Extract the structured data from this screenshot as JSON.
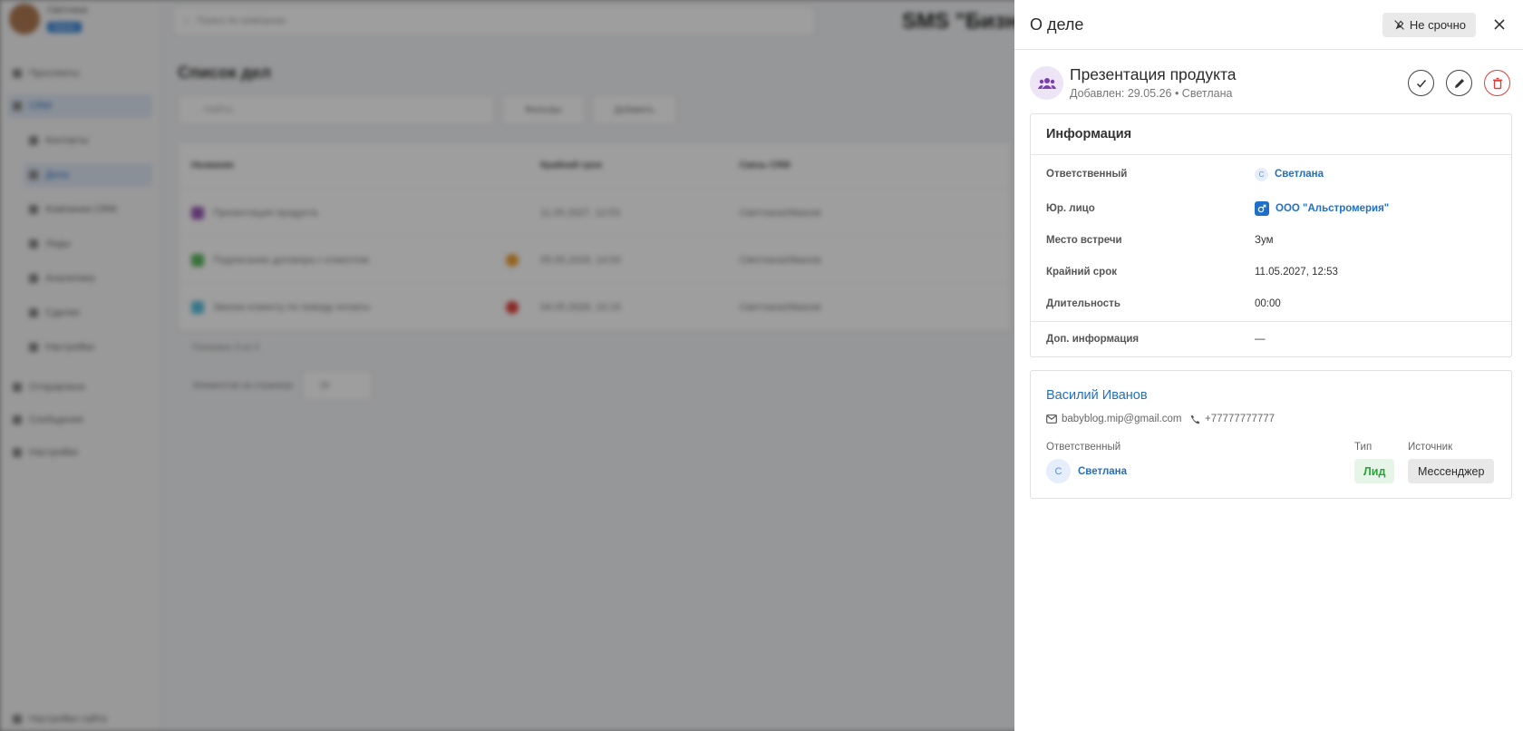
{
  "background": {
    "sidebar": {
      "user_name": "Светлана",
      "user_role": "Admin",
      "items": [
        "Проспекты",
        "CRM",
        "Контакты",
        "Дела",
        "Компании CRM",
        "Лиды",
        "Аналитика",
        "Сделки",
        "Настройки",
        "Отправлено",
        "Сообщения",
        "Настройки"
      ],
      "bottom_item": "Настройки сайта"
    },
    "search_placeholder": "Поиск по компании",
    "brand": "SMS \"Бизнес",
    "page_title": "Список дел",
    "toolbar": {
      "search_placeholder": "Найти",
      "filter_label": "Фильтры",
      "add_label": "Добавить"
    },
    "table": {
      "headers": [
        "Название",
        "Крайний срок",
        "Связь CRM"
      ],
      "rows": [
        [
          "Презентация продукта",
          "11.05.2027, 12:53",
          "Светлана/Иванов"
        ],
        [
          "Подписание договора с клиентом",
          "05.05.2026, 14:00",
          "Светлана/Иванов"
        ],
        [
          "Звонок клиенту по поводу оплаты",
          "04.05.2026, 10:15",
          "Светлана/Иванов"
        ]
      ]
    },
    "footer_text": "Показано 3 из 3",
    "pager_label": "Элементов на странице",
    "pager_value": "10"
  },
  "drawer": {
    "title": "О деле",
    "urgent_label": "Не срочно",
    "task": {
      "title": "Презентация продукта",
      "meta": "Добавлен: 29.05.26 • Светлана"
    },
    "info": {
      "heading": "Информация",
      "responsible_label": "Ответственный",
      "responsible_initial": "С",
      "responsible_value": "Светлана",
      "org_label": "Юр. лицо",
      "org_value": "ООО \"Альстромерия\"",
      "place_label": "Место встречи",
      "place_value": "Зум",
      "deadline_label": "Крайний срок",
      "deadline_value": "11.05.2027, 12:53",
      "duration_label": "Длительность",
      "duration_value": "00:00",
      "extra_label": "Доп. информация",
      "extra_value": "—"
    },
    "contact": {
      "name": "Василий Иванов",
      "email": "babyblog.mip@gmail.com",
      "phone": "+77777777777",
      "responsible_label": "Ответственный",
      "responsible_initial": "С",
      "responsible_value": "Светлана",
      "type_label": "Тип",
      "type_value": "Лид",
      "source_label": "Источник",
      "source_value": "Мессенджер"
    },
    "colors": {
      "accent": "#1f6fc9",
      "danger": "#e0403a",
      "lead_green": "#2aa33a"
    }
  }
}
